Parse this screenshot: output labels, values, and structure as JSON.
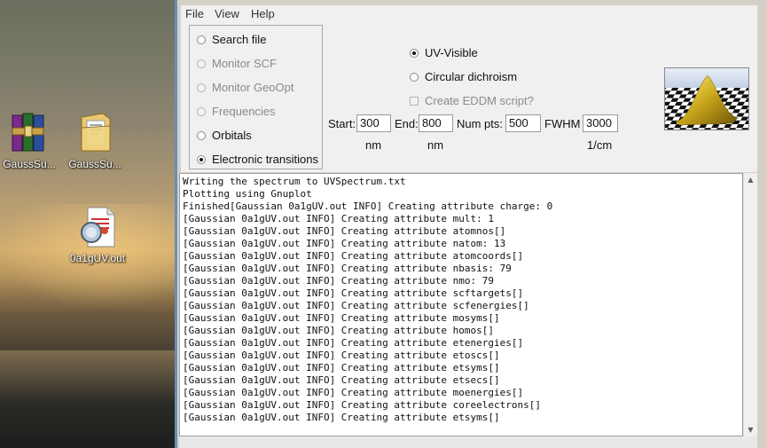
{
  "desktop": {
    "icons": [
      {
        "label": "GaussSu...",
        "icon": "winrar-archive-icon"
      },
      {
        "label": "GaussSu...",
        "icon": "folder-icon"
      },
      {
        "label": "0a1gUV.out",
        "icon": "file-icon"
      }
    ]
  },
  "menu": {
    "file": "File",
    "view": "View",
    "help": "Help"
  },
  "modes": [
    {
      "label": "Search file",
      "enabled": true,
      "selected": false
    },
    {
      "label": "Monitor SCF",
      "enabled": false,
      "selected": false
    },
    {
      "label": "Monitor GeoOpt",
      "enabled": false,
      "selected": false
    },
    {
      "label": "Frequencies",
      "enabled": false,
      "selected": false
    },
    {
      "label": "Orbitals",
      "enabled": true,
      "selected": false
    },
    {
      "label": "Electronic transitions",
      "enabled": true,
      "selected": true
    }
  ],
  "spectrum": {
    "uv_visible": "UV-Visible",
    "circular_dichroism": "Circular dichroism",
    "create_eddm": "Create EDDM script?",
    "start_label": "Start:",
    "start_value": "300",
    "end_label": "End:",
    "end_value": "800",
    "numpts_label": "Num pts:",
    "numpts_value": "500",
    "fwhm_label": "FWHM",
    "fwhm_value": "3000",
    "start_unit": "nm",
    "end_unit": "nm",
    "fwhm_unit": "1/cm"
  },
  "output": {
    "lines": [
      "Writing the spectrum to UVSpectrum.txt",
      "Plotting using Gnuplot",
      "Finished[Gaussian 0a1gUV.out INFO] Creating attribute charge: 0",
      "[Gaussian 0a1gUV.out INFO] Creating attribute mult: 1",
      "[Gaussian 0a1gUV.out INFO] Creating attribute atomnos[]",
      "[Gaussian 0a1gUV.out INFO] Creating attribute natom: 13",
      "[Gaussian 0a1gUV.out INFO] Creating attribute atomcoords[]",
      "[Gaussian 0a1gUV.out INFO] Creating attribute nbasis: 79",
      "[Gaussian 0a1gUV.out INFO] Creating attribute nmo: 79",
      "[Gaussian 0a1gUV.out INFO] Creating attribute scftargets[]",
      "[Gaussian 0a1gUV.out INFO] Creating attribute scfenergies[]",
      "[Gaussian 0a1gUV.out INFO] Creating attribute mosyms[]",
      "[Gaussian 0a1gUV.out INFO] Creating attribute homos[]",
      "[Gaussian 0a1gUV.out INFO] Creating attribute etenergies[]",
      "[Gaussian 0a1gUV.out INFO] Creating attribute etoscs[]",
      "[Gaussian 0a1gUV.out INFO] Creating attribute etsyms[]",
      "[Gaussian 0a1gUV.out INFO] Creating attribute etsecs[]",
      "[Gaussian 0a1gUV.out INFO] Creating attribute moenergies[]",
      "[Gaussian 0a1gUV.out INFO] Creating attribute coreelectrons[]",
      "[Gaussian 0a1gUV.out INFO] Creating attribute etsyms[]"
    ]
  }
}
